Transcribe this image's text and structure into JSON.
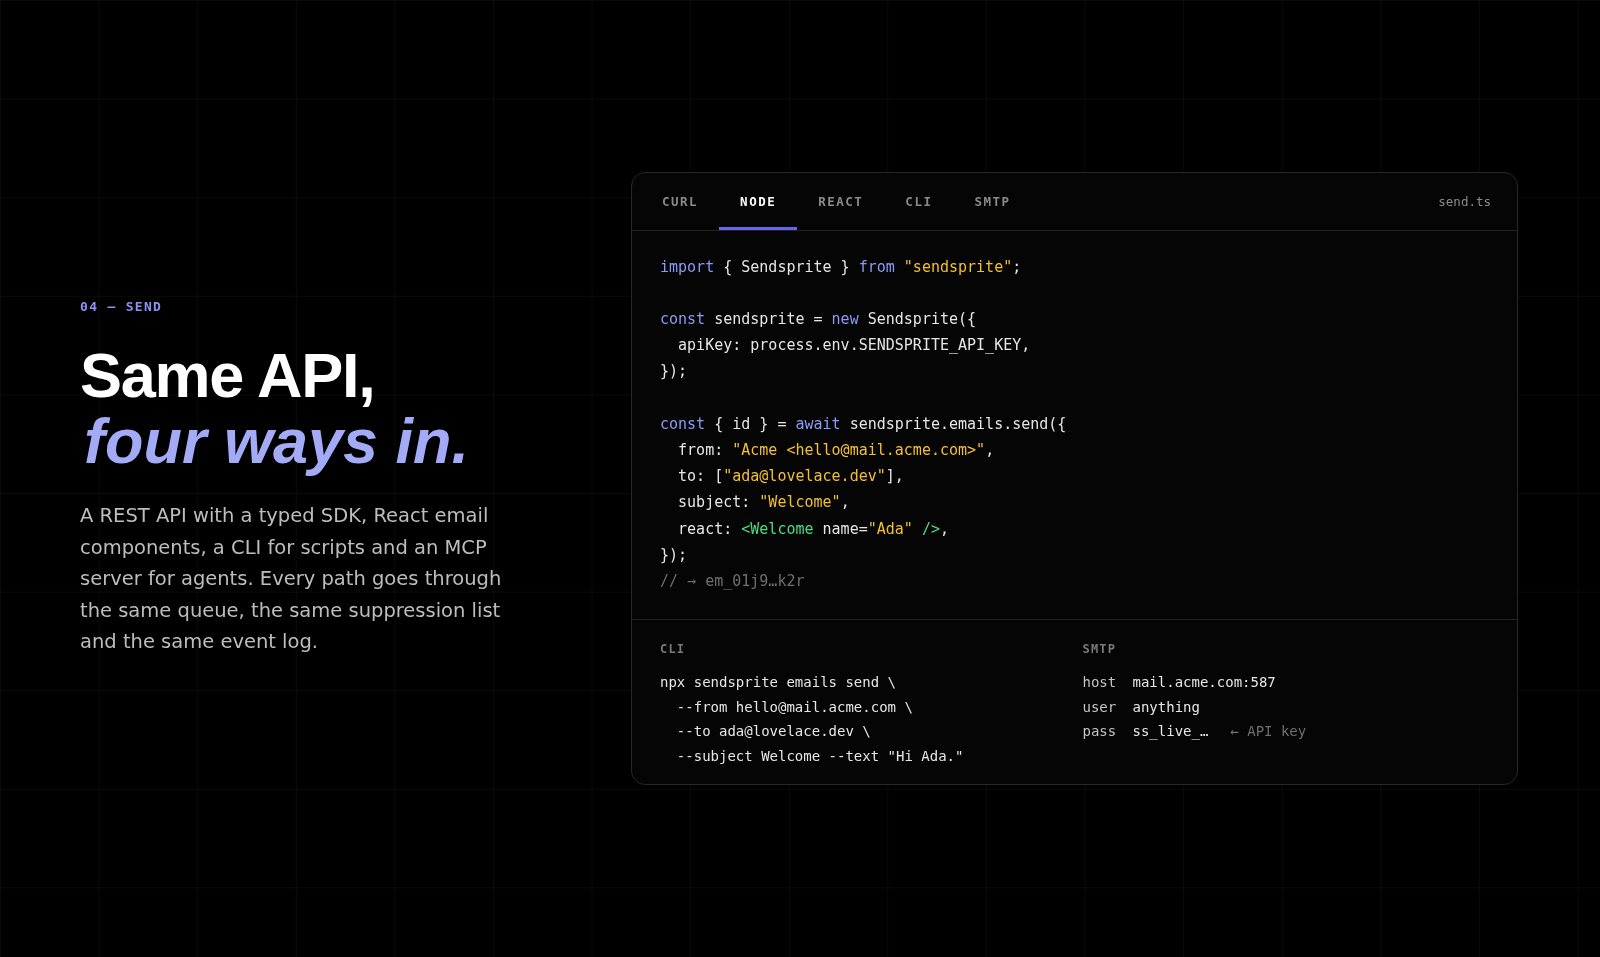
{
  "eyebrow": "04 — SEND",
  "headline": {
    "first_line": "Same API,",
    "second_line": "four ways in."
  },
  "description": "A REST API with a typed SDK, React email components, a CLI for scripts and an MCP server for agents. Every path goes through the same queue, the same suppression list and the same event log.",
  "code_card": {
    "tabs": [
      {
        "label": "CURL",
        "selected": false
      },
      {
        "label": "NODE",
        "selected": true
      },
      {
        "label": "REACT",
        "selected": false
      },
      {
        "label": "CLI",
        "selected": false
      },
      {
        "label": "SMTP",
        "selected": false
      }
    ],
    "filename": "send.ts",
    "code_blocks": [
      {
        "lines": [
          {
            "tokens": [
              {
                "kind": "keyword",
                "text": "import"
              },
              {
                "kind": "plain",
                "text": " { Sendsprite } "
              },
              {
                "kind": "keyword",
                "text": "from"
              },
              {
                "kind": "string",
                "text": " \"sendsprite\""
              },
              {
                "kind": "plain",
                "text": ";"
              }
            ]
          }
        ]
      },
      {
        "lines": [
          {
            "tokens": [
              {
                "kind": "keyword",
                "text": "const"
              },
              {
                "kind": "plain",
                "text": " sendsprite = "
              },
              {
                "kind": "keyword",
                "text": "new"
              },
              {
                "kind": "plain",
                "text": " Sendsprite({"
              }
            ]
          },
          {
            "tokens": [
              {
                "kind": "plain",
                "text": "  apiKey: process.env.SENDSPRITE_API_KEY,"
              }
            ]
          },
          {
            "tokens": [
              {
                "kind": "plain",
                "text": "});"
              }
            ]
          }
        ]
      },
      {
        "lines": [
          {
            "tokens": [
              {
                "kind": "keyword",
                "text": "const"
              },
              {
                "kind": "plain",
                "text": " { id } = "
              },
              {
                "kind": "keyword",
                "text": "await"
              },
              {
                "kind": "plain",
                "text": " sendsprite.emails.send({"
              }
            ]
          },
          {
            "tokens": [
              {
                "kind": "plain",
                "text": "  from: "
              },
              {
                "kind": "string",
                "text": "\"Acme <hello@mail.acme.com>\""
              },
              {
                "kind": "plain",
                "text": ","
              }
            ]
          },
          {
            "tokens": [
              {
                "kind": "plain",
                "text": "  to: ["
              },
              {
                "kind": "string",
                "text": "\"ada@lovelace.dev\""
              },
              {
                "kind": "plain",
                "text": "],"
              }
            ]
          },
          {
            "tokens": [
              {
                "kind": "plain",
                "text": "  subject: "
              },
              {
                "kind": "string",
                "text": "\"Welcome\""
              },
              {
                "kind": "plain",
                "text": ","
              }
            ]
          },
          {
            "tokens": [
              {
                "kind": "plain",
                "text": "  react: "
              },
              {
                "kind": "tag",
                "text": "<Welcome"
              },
              {
                "kind": "plain",
                "text": " name="
              },
              {
                "kind": "string",
                "text": "\"Ada\""
              },
              {
                "kind": "tag",
                "text": " />"
              },
              {
                "kind": "plain",
                "text": ","
              }
            ]
          },
          {
            "tokens": [
              {
                "kind": "plain",
                "text": "});"
              }
            ]
          },
          {
            "tokens": [
              {
                "kind": "comment",
                "text": "// → em_01j9…k2r"
              }
            ]
          }
        ]
      }
    ],
    "cli": {
      "label": "CLI",
      "lines": [
        "npx sendsprite emails send \\",
        "  --from hello@mail.acme.com \\",
        "  --to ada@lovelace.dev \\",
        "  --subject Welcome --text \"Hi Ada.\""
      ]
    },
    "smtp": {
      "label": "SMTP",
      "rows": [
        {
          "key": "host",
          "value": "mail.acme.com:587"
        },
        {
          "key": "user",
          "value": "anything"
        },
        {
          "key": "pass",
          "value": "ss_live_…",
          "note": "← API key"
        }
      ]
    }
  }
}
